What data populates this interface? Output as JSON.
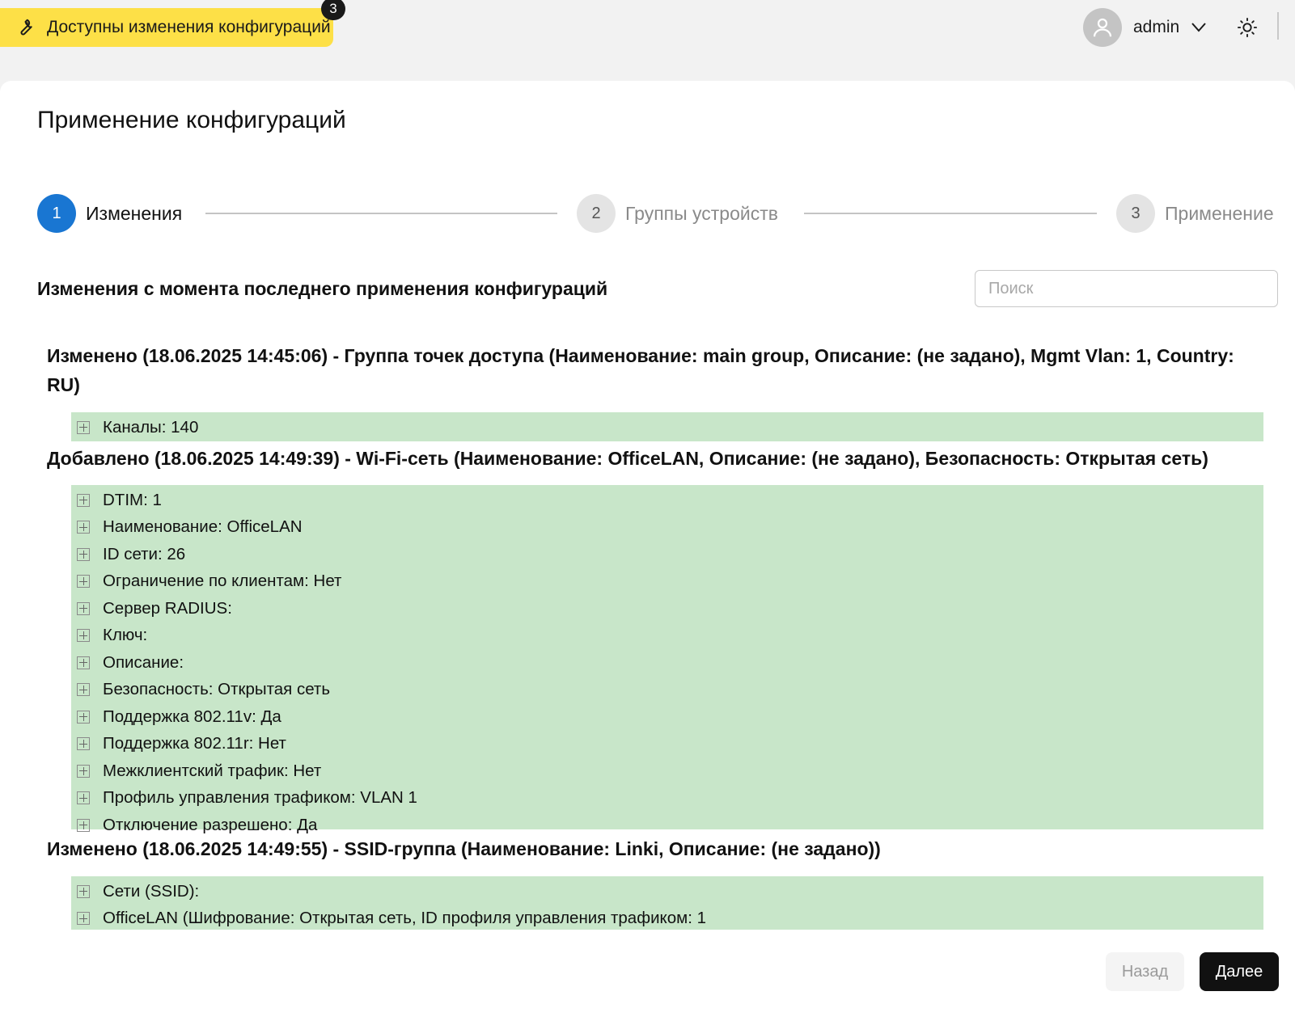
{
  "header": {
    "config_button_label": "Доступны изменения конфигураций",
    "config_badge_count": "3",
    "username": "admin"
  },
  "page": {
    "title": "Применение конфигураций"
  },
  "stepper": {
    "steps": [
      {
        "number": "1",
        "label": "Изменения",
        "state": "active"
      },
      {
        "number": "2",
        "label": "Группы устройств",
        "state": "inactive"
      },
      {
        "number": "3",
        "label": "Применение",
        "state": "inactive"
      }
    ]
  },
  "changes": {
    "section_title": "Изменения с момента последнего применения конфигураций",
    "search_placeholder": "Поиск",
    "groups": [
      {
        "header": "Изменено (18.06.2025 14:45:06) - Группа точек доступа (Наименование: main group, Описание: (не задано), Mgmt Vlan: 1, Country: RU)",
        "items": [
          "Каналы: 140"
        ]
      },
      {
        "header": "Добавлено (18.06.2025 14:49:39) - Wi-Fi-сеть (Наименование: OfficeLAN, Описание: (не задано), Безопасность: Открытая сеть)",
        "items": [
          "DTIM: 1",
          "Наименование: OfficeLAN",
          "ID сети: 26",
          "Ограничение по клиентам: Нет",
          "Сервер RADIUS:",
          "Ключ:",
          "Описание:",
          "Безопасность: Открытая сеть",
          "Поддержка 802.11v: Да",
          "Поддержка 802.11r: Нет",
          "Межклиентский трафик: Нет",
          "Профиль управления трафиком: VLAN 1",
          "Отключение разрешено: Да"
        ]
      },
      {
        "header": "Изменено (18.06.2025 14:49:55) - SSID-группа (Наименование: Linki, Описание: (не задано))",
        "items": [
          "Сети (SSID):",
          "OfficeLAN (Шифрование: Открытая сеть, ID профиля управления трафиком: 1"
        ]
      }
    ]
  },
  "footer": {
    "back_label": "Назад",
    "next_label": "Далее"
  },
  "colors": {
    "accent": "#1976d2",
    "config_button": "#fde047",
    "change_block": "#c8e6c9",
    "primary_button": "#111111"
  }
}
